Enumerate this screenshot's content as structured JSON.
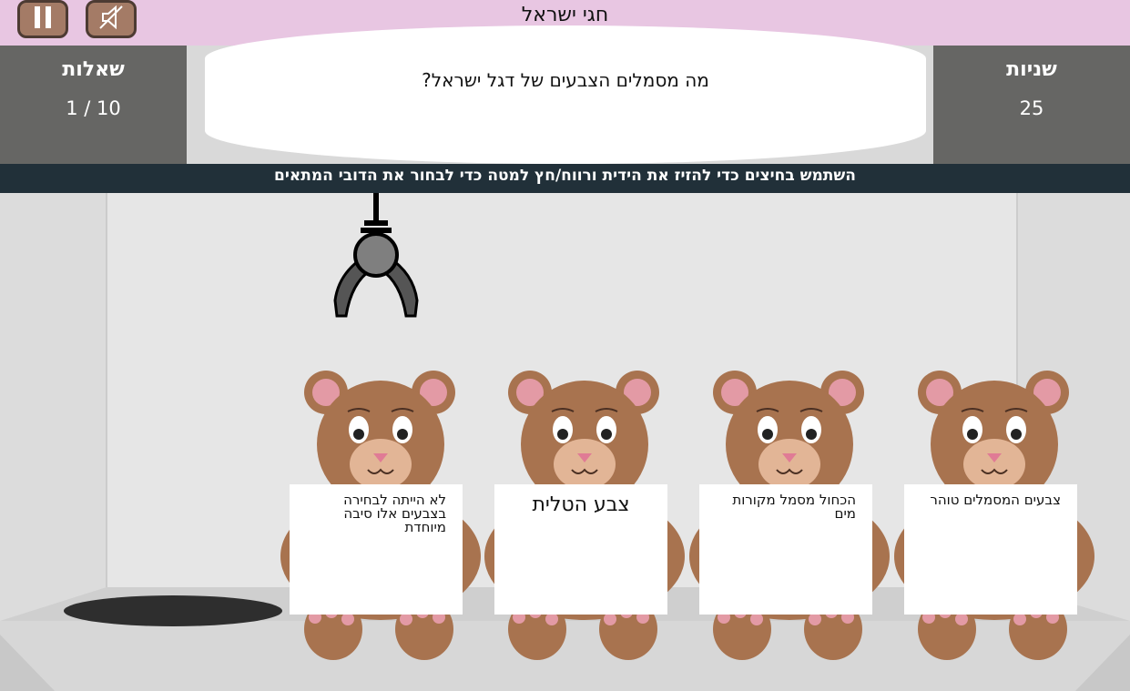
{
  "header": {
    "title": "חגי ישראל"
  },
  "controls": {
    "pause_icon": "pause-icon",
    "sound_icon": "sound-muted-icon"
  },
  "questions_panel": {
    "label": "שאלות",
    "progress": "1 / 10"
  },
  "timer_panel": {
    "label": "שניות",
    "value": "25"
  },
  "question": {
    "text": "מה מסמלים הצבעים של דגל ישראל?"
  },
  "instruction": {
    "text": "השתמש בחיצים כדי להזיז את הידית ורווח/חץ למטה כדי לבחור את הדובי המתאים"
  },
  "answers": [
    {
      "text": "לא הייתה לבחירה בצבעים אלו סיבה מיוחדת"
    },
    {
      "text": "צבע הטלית"
    },
    {
      "text": "הכחול מסמל מקורות מים"
    },
    {
      "text": "צבעים המסמלים טוהר"
    }
  ],
  "colors": {
    "header_bg": "#e8c6e2",
    "panel_bg": "#666664",
    "instruction_bg": "#213039",
    "bear_fur": "#a8734f",
    "button_bg": "#a47b66"
  }
}
